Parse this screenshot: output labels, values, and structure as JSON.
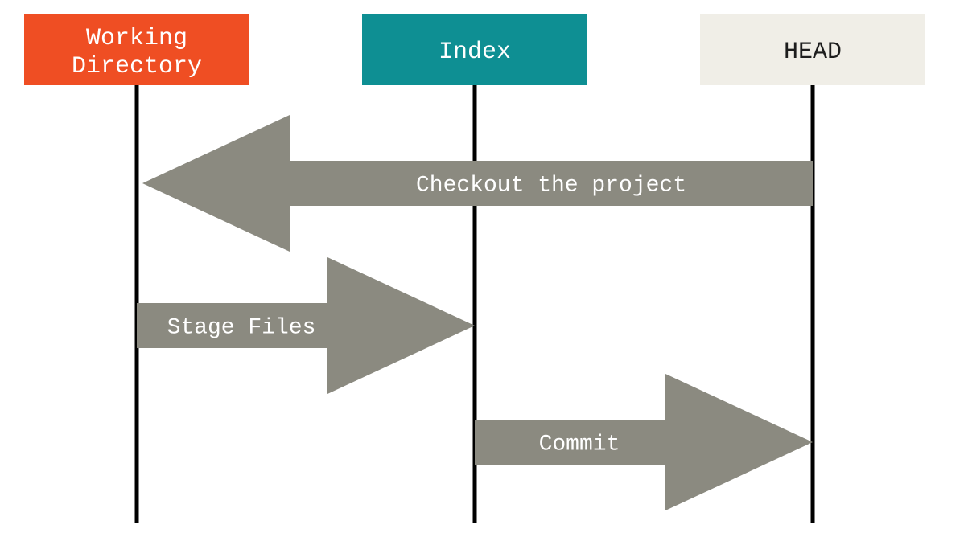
{
  "boxes": {
    "working_directory": {
      "line1": "Working",
      "line2": "Directory",
      "color": "#ef4e23"
    },
    "index": {
      "label": "Index",
      "color": "#0e8f93"
    },
    "head": {
      "label": "HEAD",
      "color": "#f0eee7"
    }
  },
  "arrows": {
    "checkout": {
      "label": "Checkout the project",
      "direction": "left",
      "from": "head",
      "to": "working_directory"
    },
    "stage": {
      "label": "Stage Files",
      "direction": "right",
      "from": "working_directory",
      "to": "index"
    },
    "commit": {
      "label": "Commit",
      "direction": "right",
      "from": "index",
      "to": "head"
    }
  },
  "colors": {
    "arrow_fill": "#8b8a80",
    "line": "#000000"
  }
}
